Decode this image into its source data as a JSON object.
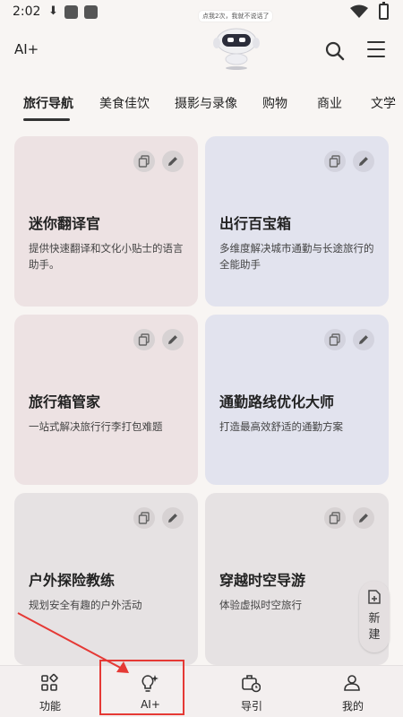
{
  "status_bar": {
    "time": "2:02",
    "battery": ""
  },
  "header": {
    "app_title": "AI+",
    "robot_bubble": "点我2次，我就不说话了"
  },
  "tabs": [
    {
      "label": "旅行导航",
      "active": true
    },
    {
      "label": "美食佳饮"
    },
    {
      "label": "摄影与录像"
    },
    {
      "label": "购物"
    },
    {
      "label": "商业"
    },
    {
      "label": "文学"
    }
  ],
  "cards": [
    {
      "title": "迷你翻译官",
      "desc": "提供快速翻译和文化小贴士的语言助手。"
    },
    {
      "title": "出行百宝箱",
      "desc": "多维度解决城市通勤与长途旅行的全能助手"
    },
    {
      "title": "旅行箱管家",
      "desc": "一站式解决旅行行李打包难题"
    },
    {
      "title": "通勤路线优化大师",
      "desc": "打造最高效舒适的通勤方案"
    },
    {
      "title": "户外探险教练",
      "desc": "规划安全有趣的户外活动"
    },
    {
      "title": "穿越时空导游",
      "desc": "体验虚拟时空旅行"
    }
  ],
  "fab": {
    "label_1": "新",
    "label_2": "建"
  },
  "bottom_nav": [
    {
      "label": "功能"
    },
    {
      "label": "AI+"
    },
    {
      "label": "导引"
    },
    {
      "label": "我的"
    }
  ],
  "colors": {
    "highlight": "#e53935",
    "card_pink": "#ede2e3",
    "card_blue": "#e2e3ee"
  }
}
